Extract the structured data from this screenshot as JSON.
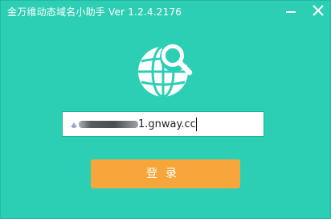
{
  "window": {
    "title": "金万维动态域名小助手 Ver 1.2.4.2176"
  },
  "controls": {
    "minimize_icon": "minimize-icon",
    "close_icon": "close-icon"
  },
  "logo": {
    "icon": "globe-search-icon"
  },
  "form": {
    "host_value": "1.gnway.cc",
    "host_redacted_prefix": true
  },
  "actions": {
    "login_label": "登录"
  },
  "colors": {
    "background": "#2dcfb4",
    "button": "#f6a63a",
    "text": "#ffffff"
  }
}
